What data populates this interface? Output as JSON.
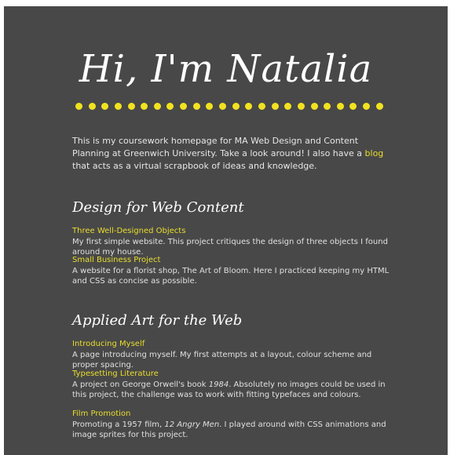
{
  "header": {
    "title": "Hi, I'm Natalia",
    "dot_count": 24,
    "dot_color": "#f2e21f"
  },
  "intro": {
    "text_before": "This is my coursework homepage for MA Web Design and Content Planning at Greenwich University. Take a look around! I also have a ",
    "link_text": "blog",
    "text_after": " that acts as a virtual scrapbook of ideas and knowledge."
  },
  "sections": [
    {
      "heading": "Design for Web Content",
      "projects": [
        {
          "link": "Three Well-Designed Objects",
          "desc": "My first simple website. This project critiques the design of three objects I found around my house."
        },
        {
          "link": "Small Business Project",
          "desc": "A website for a florist shop, The Art of Bloom. Here I practiced keeping my HTML and CSS as concise as possible."
        }
      ]
    },
    {
      "heading": "Applied Art for the Web",
      "projects": [
        {
          "link": "Introducing Myself",
          "desc": "A page introducing myself. My first attempts at a layout, colour scheme and proper spacing."
        },
        {
          "link": "Typesetting Literature",
          "desc_before": "A project on George Orwell's book ",
          "desc_em": "1984",
          "desc_after": ". Absolutely no images could be used in this project, the challenge was to work with fitting typefaces and colours."
        },
        {
          "link": "Film Promotion",
          "desc_before": "Promoting a 1957 film, ",
          "desc_em": "12 Angry Men",
          "desc_after": ". I played around with CSS animations and image sprites for this project."
        }
      ]
    }
  ],
  "colors": {
    "page_background": "#484848",
    "accent_link": "#e9dd2c",
    "text": "#e6e6e6"
  }
}
